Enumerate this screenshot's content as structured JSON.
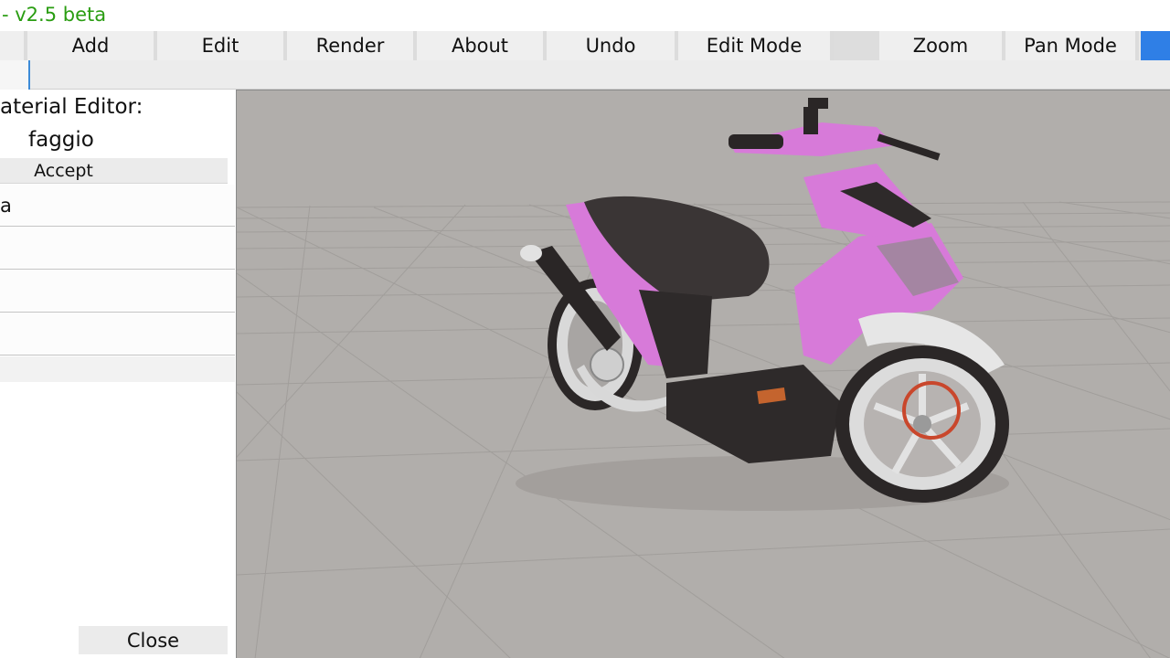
{
  "window": {
    "title": "- v2.5 beta",
    "title_color": "#2a9d12"
  },
  "menu": [
    {
      "label": "Add"
    },
    {
      "label": "Edit"
    },
    {
      "label": "Render"
    },
    {
      "label": "About"
    },
    {
      "label": "Undo"
    },
    {
      "label": "Edit Mode"
    },
    {
      "label": "Zoom"
    },
    {
      "label": "Pan Mode"
    }
  ],
  "material_editor": {
    "title": "aterial Editor:",
    "material_name": "faggio",
    "accept_label": "Accept",
    "rows": [
      "a",
      "",
      "",
      "",
      ""
    ],
    "close_label": "Close"
  },
  "viewport": {
    "background": "#b1aeab",
    "model_colors": {
      "body": "#d77ad9",
      "seat": "#3a3535",
      "frame": "#2e2a2a",
      "chrome": "#dcdcdc"
    }
  }
}
